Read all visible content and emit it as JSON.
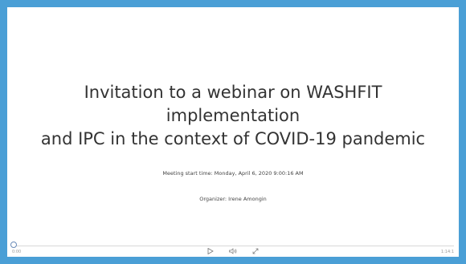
{
  "slide": {
    "title_line1": "Invitation to a webinar on WASHFIT implementation",
    "title_line2": "and IPC in the context of COVID-19 pandemic",
    "meeting_start": "Meeting start time: Monday, April 6, 2020 9:00:16 AM",
    "organizer": "Organizer: Irene Amongin"
  },
  "player": {
    "elapsed": "0:00",
    "total": "1:14:1",
    "icons": [
      "play-icon",
      "volume-icon",
      "fullscreen-icon"
    ]
  },
  "colors": {
    "frame": "#4a9fd6",
    "background": "#ffffff",
    "text": "#333333"
  }
}
